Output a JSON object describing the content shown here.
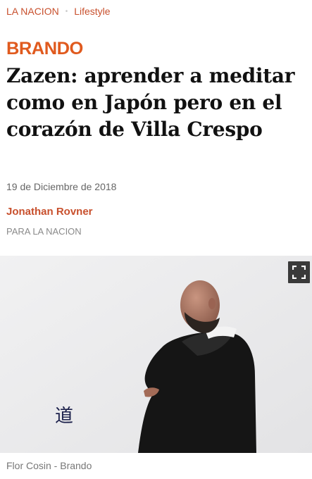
{
  "breadcrumb": {
    "section": "LA NACION",
    "separator": "•",
    "subsection": "Lifestyle"
  },
  "brand": {
    "logo_text": "BRANDO"
  },
  "article": {
    "headline": "Zazen: aprender a meditar como en Japón pero en el corazón de Villa Crespo",
    "date": "19 de Diciembre de 2018",
    "author": "Jonathan Rovner",
    "outlet": "PARA LA NACION"
  },
  "photo": {
    "caption": "Flor Cosin - Brando",
    "fullscreen_icon": "expand-icon",
    "calligraphy": "道"
  },
  "colors": {
    "accent": "#c8502d",
    "brand": "#e05a1e"
  }
}
